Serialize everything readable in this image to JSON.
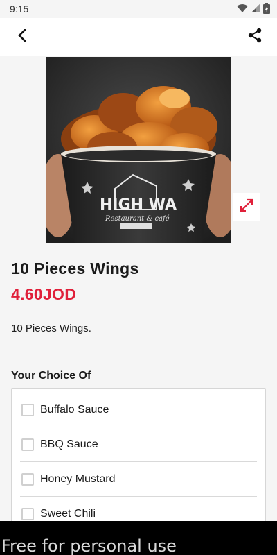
{
  "status_bar": {
    "time": "9:15",
    "icons": [
      "wifi-icon",
      "signal-icon",
      "battery-icon"
    ]
  },
  "app_bar": {
    "back_icon": "back-arrow-icon",
    "share_icon": "share-icon"
  },
  "hero": {
    "image_text_line1": "HIGH WA",
    "image_text_line2": "Restaurant & café",
    "expand_icon": "expand-icon"
  },
  "product": {
    "title": "10 Pieces Wings",
    "price": "4.60JOD",
    "description": "10 Pieces Wings."
  },
  "options": {
    "section_title": "Your Choice Of",
    "items": [
      {
        "label": "Buffalo Sauce",
        "checked": false
      },
      {
        "label": "BBQ Sauce",
        "checked": false
      },
      {
        "label": "Honey Mustard",
        "checked": false
      },
      {
        "label": "Sweet Chili",
        "checked": false
      }
    ]
  },
  "banner": {
    "text": "Free for personal use"
  },
  "colors": {
    "price": "#e0203a",
    "banner_bg": "#000000"
  }
}
